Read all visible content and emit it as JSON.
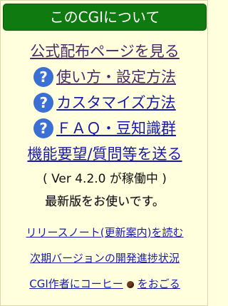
{
  "header": {
    "title": "このCGIについて"
  },
  "links": {
    "official": "公式配布ページを見る",
    "usage": "使い方・設定方法",
    "customize": "カスタマイズ方法",
    "faq": "ＦＡＱ・豆知識群",
    "request": "機能要望/質問等を送る"
  },
  "help_icon": {
    "glyph": "?"
  },
  "version": {
    "text": "( Ver 4.2.0 が稼働中 )",
    "status": "最新版をお使いです。"
  },
  "footer": {
    "release_notes": "リリースノート(更新案内)を読む",
    "progress": "次期バージョンの開発進捗状況",
    "coffee_before": "CGI作者にコーヒー",
    "coffee_after": "をおごる"
  },
  "colors": {
    "background": "#ffffdd",
    "header": "#0f7a0f",
    "help_icon": "#3a6fd4",
    "link": "#1a1aa8",
    "visited_link": "#4a2a6a"
  }
}
